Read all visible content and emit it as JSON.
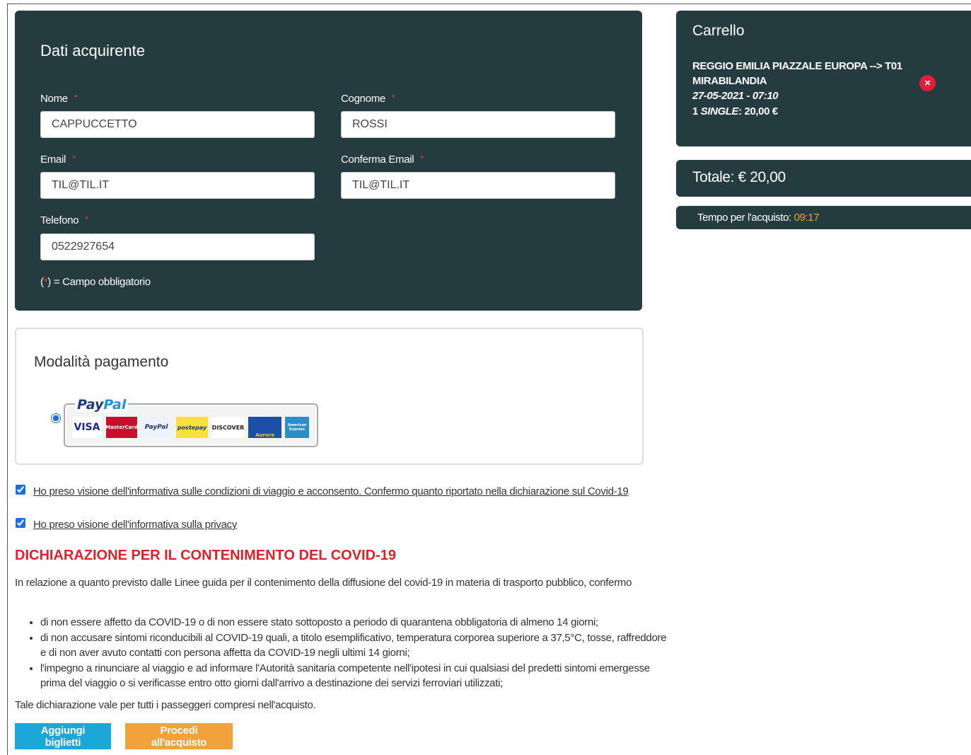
{
  "buyer": {
    "title": "Dati acquirente",
    "fields": {
      "nome": {
        "label": "Nome",
        "value": "CAPPUCCETTO"
      },
      "cognome": {
        "label": "Cognome",
        "value": "ROSSI"
      },
      "email": {
        "label": "Email",
        "value": "TIL@TIL.IT"
      },
      "confirm_email": {
        "label": "Conferma Email",
        "value": "TIL@TIL.IT"
      },
      "telefono": {
        "label": "Telefono",
        "value": "0522927654"
      }
    },
    "required_mark": "*",
    "note_open": "(",
    "note_close": ") = Campo obbligatorio"
  },
  "payment": {
    "title": "Modalità pagamento",
    "logo_word_1": "Pay",
    "logo_word_2": "Pal",
    "cards": [
      "VISA",
      "MasterCard",
      "PayPal",
      "postepay",
      "DISCOVER",
      "Aurora",
      "American Express"
    ]
  },
  "consents": {
    "terms": "Ho preso visione dell'informativa sulle condizioni di viaggio e acconsento. Confermo quanto riportato nella dichiarazione sul Covid-19",
    "privacy": "Ho preso visione dell'informativa sulla privacy"
  },
  "covid": {
    "title": "DICHIARAZIONE PER IL CONTENIMENTO DEL COVID-19",
    "intro": "In relazione a quanto previsto dalle Linee guida per il contenimento della diffusione del covid-19 in materia di trasporto pubblico, confermo",
    "items": [
      "di non essere affetto da COVID-19 o di non essere stato sottoposto a periodo di quarantena obbligatoria di almeno 14 giorni;",
      "di non accusare sintomi riconducibili al COVID-19 quali, a titolo esemplificativo, temperatura corporea superiore a 37,5°C, tosse, raffreddore e di non aver avuto contatti con persona affetta da COVID-19 negli ultimi 14 giorni;",
      "l'impegno a rinunciare al viaggio e ad informare l'Autorità sanitaria competente nell'ipotesi in cui qualsiasi del predetti sintomi emergesse prima del viaggio o si verificasse entro otto giorni dall'arrivo a destinazione dei servizi ferroviari utilizzati;"
    ],
    "footer": "Tale dichiarazione vale per tutti i passeggeri compresi nell'acquisto."
  },
  "buttons": {
    "add": "Aggiungi biglietti",
    "proceed": "Procedi all'acquisto"
  },
  "cart": {
    "title": "Carrello",
    "route": "REGGIO EMILIA PIAZZALE EUROPA --> T01 MIRABILANDIA",
    "datetime": "27-05-2021 - 07:10",
    "qty_prefix": "1 ",
    "fare": "SINGLE",
    "price": ": 20,00 €",
    "remove_icon": "×"
  },
  "total": {
    "text": "Totale: € 20,00"
  },
  "timer": {
    "label": "Tempo per l'acquisto: ",
    "time": "09:17"
  },
  "colors": {
    "panel": "#243b3f",
    "accent_red": "#d9232d",
    "button_blue": "#1ba7d8",
    "button_orange": "#f2a23a"
  }
}
